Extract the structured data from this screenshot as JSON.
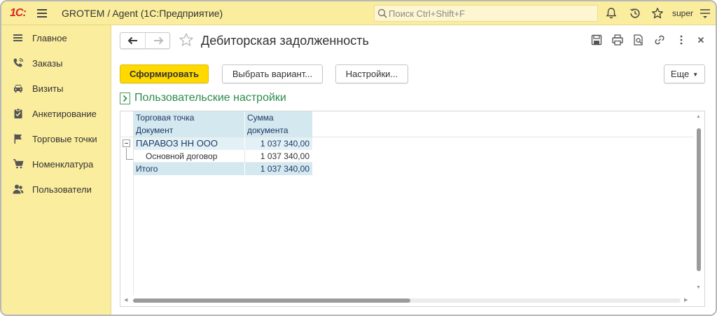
{
  "topbar": {
    "logo": "1С:",
    "app_title": "GROTEM / Agent  (1С:Предприятие)",
    "search_placeholder": "Поиск Ctrl+Shift+F",
    "user": "super"
  },
  "sidebar": {
    "items": [
      {
        "label": "Главное",
        "icon": "menu-lines-icon"
      },
      {
        "label": "Заказы",
        "icon": "phone-icon"
      },
      {
        "label": "Визиты",
        "icon": "car-icon"
      },
      {
        "label": "Анкетирование",
        "icon": "clipboard-icon"
      },
      {
        "label": "Торговые точки",
        "icon": "flag-icon"
      },
      {
        "label": "Номенклатура",
        "icon": "cart-icon"
      },
      {
        "label": "Пользователи",
        "icon": "users-icon"
      }
    ]
  },
  "form": {
    "title": "Дебиторская задолженность",
    "buttons": {
      "generate": "Сформировать",
      "choose_variant": "Выбрать вариант...",
      "settings": "Настройки...",
      "more": "Еще"
    },
    "user_settings_label": "Пользовательские настройки"
  },
  "report": {
    "header": {
      "col1_line1": "Торговая точка",
      "col1_line2": "Документ",
      "col2_line1": "Сумма",
      "col2_line2": "документа"
    },
    "rows": [
      {
        "name": "ПАРАВОЗ НН ООО",
        "amount": "1 037 340,00",
        "kind": "group"
      },
      {
        "name": "Основной договор",
        "amount": "1 037 340,00",
        "kind": "detail"
      }
    ],
    "total": {
      "name": "Итого",
      "amount": "1 037 340,00"
    }
  },
  "colors": {
    "panel_bg": "#fbed9e",
    "primary_button": "#ffd900",
    "header_cell": "#d3e8ef",
    "link_green": "#2e8b4e"
  }
}
